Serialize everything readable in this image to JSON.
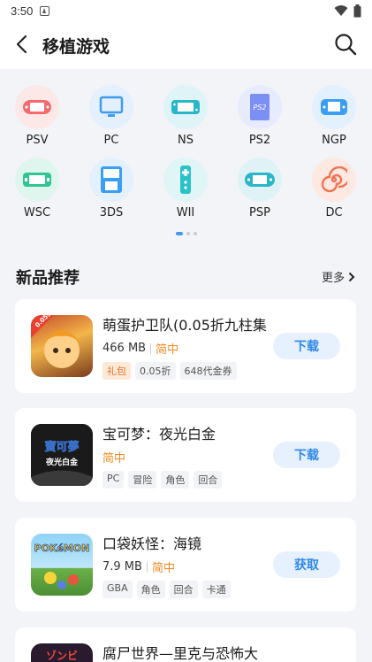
{
  "status": {
    "time": "3:50"
  },
  "header": {
    "title": "移植游戏"
  },
  "platforms": [
    {
      "label": "PSV",
      "color": "#f46a6a",
      "bg": "#fde8e8"
    },
    {
      "label": "PC",
      "color": "#3e9cf0",
      "bg": "#e4f0fd"
    },
    {
      "label": "NS",
      "color": "#28b7c9",
      "bg": "#dff4f7"
    },
    {
      "label": "PS2",
      "color": "#6f86f3",
      "bg": "#e6ebfd"
    },
    {
      "label": "NGP",
      "color": "#3a9ef5",
      "bg": "#e3f0fd"
    },
    {
      "label": "WSC",
      "color": "#2fc592",
      "bg": "#dff6ee"
    },
    {
      "label": "3DS",
      "color": "#3a9ef5",
      "bg": "#e3f0fd"
    },
    {
      "label": "WII",
      "color": "#28c2c7",
      "bg": "#dff5f6"
    },
    {
      "label": "PSP",
      "color": "#2ab6c9",
      "bg": "#dff3f6"
    },
    {
      "label": "DC",
      "color": "#f2734f",
      "bg": "#fde8e2"
    }
  ],
  "section": {
    "title": "新品推荐",
    "more": "更多"
  },
  "games": [
    {
      "name": "萌蛋护卫队(0.05折九柱集",
      "size": "466 MB",
      "lang": "简中",
      "tags": [
        "礼包",
        "0.05折",
        "648代金券"
      ],
      "button": "下载"
    },
    {
      "name": "宝可梦：夜光白金",
      "size": "",
      "lang": "简中",
      "tags": [
        "PC",
        "冒险",
        "角色",
        "回合"
      ],
      "button": "下载"
    },
    {
      "name": "口袋妖怪：海镜",
      "size": "7.9 MB",
      "lang": "简中",
      "tags": [
        "GBA",
        "角色",
        "回合",
        "卡通"
      ],
      "button": "获取"
    },
    {
      "name": "腐尸世界—里克与恐怖大",
      "size": "",
      "lang": "",
      "tags": [],
      "button": ""
    }
  ],
  "thumb_texts": {
    "g1_badge": "0.05折",
    "g2_title": "寶可夢",
    "g2_sub": "夜光白金",
    "g3_title": "POKéMON",
    "g4_title": "ゾンビ"
  }
}
